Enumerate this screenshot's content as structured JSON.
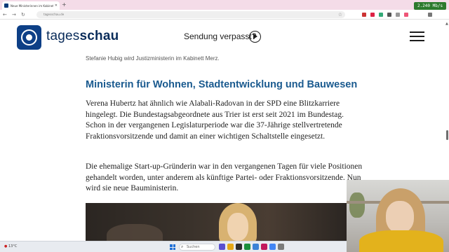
{
  "browser": {
    "tab_title": "Neue Ministerinnen im Kabinett Merz",
    "url": "tagesschau.de",
    "network_badge": "2.240 Mb/s",
    "new_tab_label": "+",
    "minimize_label": "–",
    "maximize_label": "□",
    "close_label": "✕"
  },
  "header": {
    "logo_prefix": "tages",
    "logo_suffix": "schau",
    "missed_show_label": "Sendung verpasst?"
  },
  "article": {
    "image_caption": "Stefanie Hubig wird Justizministerin im Kabinett Merz.",
    "section_heading": "Ministerin für Wohnen, Stadtentwicklung und Bauwesen",
    "paragraph_1": "Verena Hubertz hat ähnlich wie Alabali-Radovan in der SPD eine Blitzkarriere hingelegt. Die Bundestagsabgeordnete aus Trier ist erst seit 2021 im Bundestag. Schon in der vergangenen Legislaturperiode war die 37-Jährige stellvertretende Fraktionsvorsitzende und damit an einer wichtigen Schaltstelle eingesetzt.",
    "paragraph_2": "Die ehemalige Start-up-Gründerin war in den vergangenen Tagen für viele Positionen gehandelt worden, unter anderem als künftige Partei- oder Fraktionsvorsitzende. Nun wird sie neue Bauministerin."
  },
  "taskbar": {
    "weather": "13°C",
    "search_placeholder": "Suchen"
  }
}
